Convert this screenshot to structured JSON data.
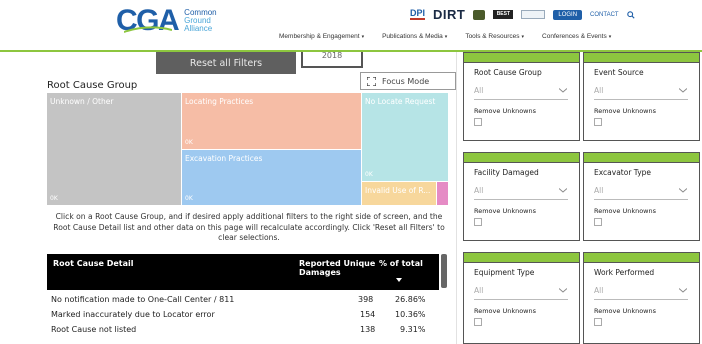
{
  "header": {
    "logo": {
      "text": "CGA",
      "line1": "Common",
      "line2": "Ground",
      "line3": "Alliance"
    },
    "topbar": {
      "dpi": "DPI",
      "dirt": "DIRT",
      "best": "BEST",
      "login": "LOGIN",
      "contact": "CONTACT"
    },
    "nav": [
      {
        "label": "Membership & Engagement"
      },
      {
        "label": "Publications & Media"
      },
      {
        "label": "Tools & Resources"
      },
      {
        "label": "Conferences & Events"
      }
    ]
  },
  "report": {
    "reset_label": "Reset all Filters",
    "year": "2018",
    "root_cause_title": "Root Cause Group",
    "focus_mode": "Focus Mode",
    "treemap": [
      {
        "label": "Unknown / Other",
        "value": "0K",
        "color": "#c4c4c4"
      },
      {
        "label": "Locating Practices",
        "value": "0K",
        "color": "#f6bda6"
      },
      {
        "label": "No Locate Request",
        "value": "0K",
        "color": "#b6e4e6"
      },
      {
        "label": "Excavation Practices",
        "value": "0K",
        "color": "#9ec9f0"
      },
      {
        "label": "Invalid Use of R...",
        "value": "",
        "color": "#f7d79c"
      },
      {
        "label": "",
        "value": "",
        "color": "#e58bc5"
      }
    ],
    "instructions": "Click on a Root Cause Group, and if desired apply additional filters to the right side of screen, and the Root Cause Detail list and other data on this page will recalculate accordingly.  Click 'Reset all Filters' to clear selections.",
    "table": {
      "headers": {
        "detail": "Root Cause Detail",
        "damages_1": "Reported Unique",
        "damages_2": "Damages",
        "pct": "% of total"
      },
      "rows": [
        {
          "detail": "No notification made to One-Call Center / 811",
          "damages": "398",
          "pct": "26.86%"
        },
        {
          "detail": "Marked inaccurately due to Locator error",
          "damages": "154",
          "pct": "10.36%"
        },
        {
          "detail": "Root Cause not listed",
          "damages": "138",
          "pct": "9.31%"
        }
      ]
    }
  },
  "filters": [
    {
      "title": "Root Cause Group",
      "value": "All",
      "remove_label": "Remove Unknowns"
    },
    {
      "title": "Event Source",
      "value": "All",
      "remove_label": "Remove Unknowns"
    },
    {
      "title": "Facility Damaged",
      "value": "All",
      "remove_label": "Remove Unknowns"
    },
    {
      "title": "Excavator Type",
      "value": "All",
      "remove_label": "Remove Unknowns"
    },
    {
      "title": "Equipment Type",
      "value": "All",
      "remove_label": "Remove Unknowns"
    },
    {
      "title": "Work Performed",
      "value": "All",
      "remove_label": "Remove Unknowns"
    }
  ],
  "colors": {
    "accent_green": "#8dc63f",
    "brand_blue": "#1f5fa8",
    "reset_gray": "#5f5f5f"
  }
}
